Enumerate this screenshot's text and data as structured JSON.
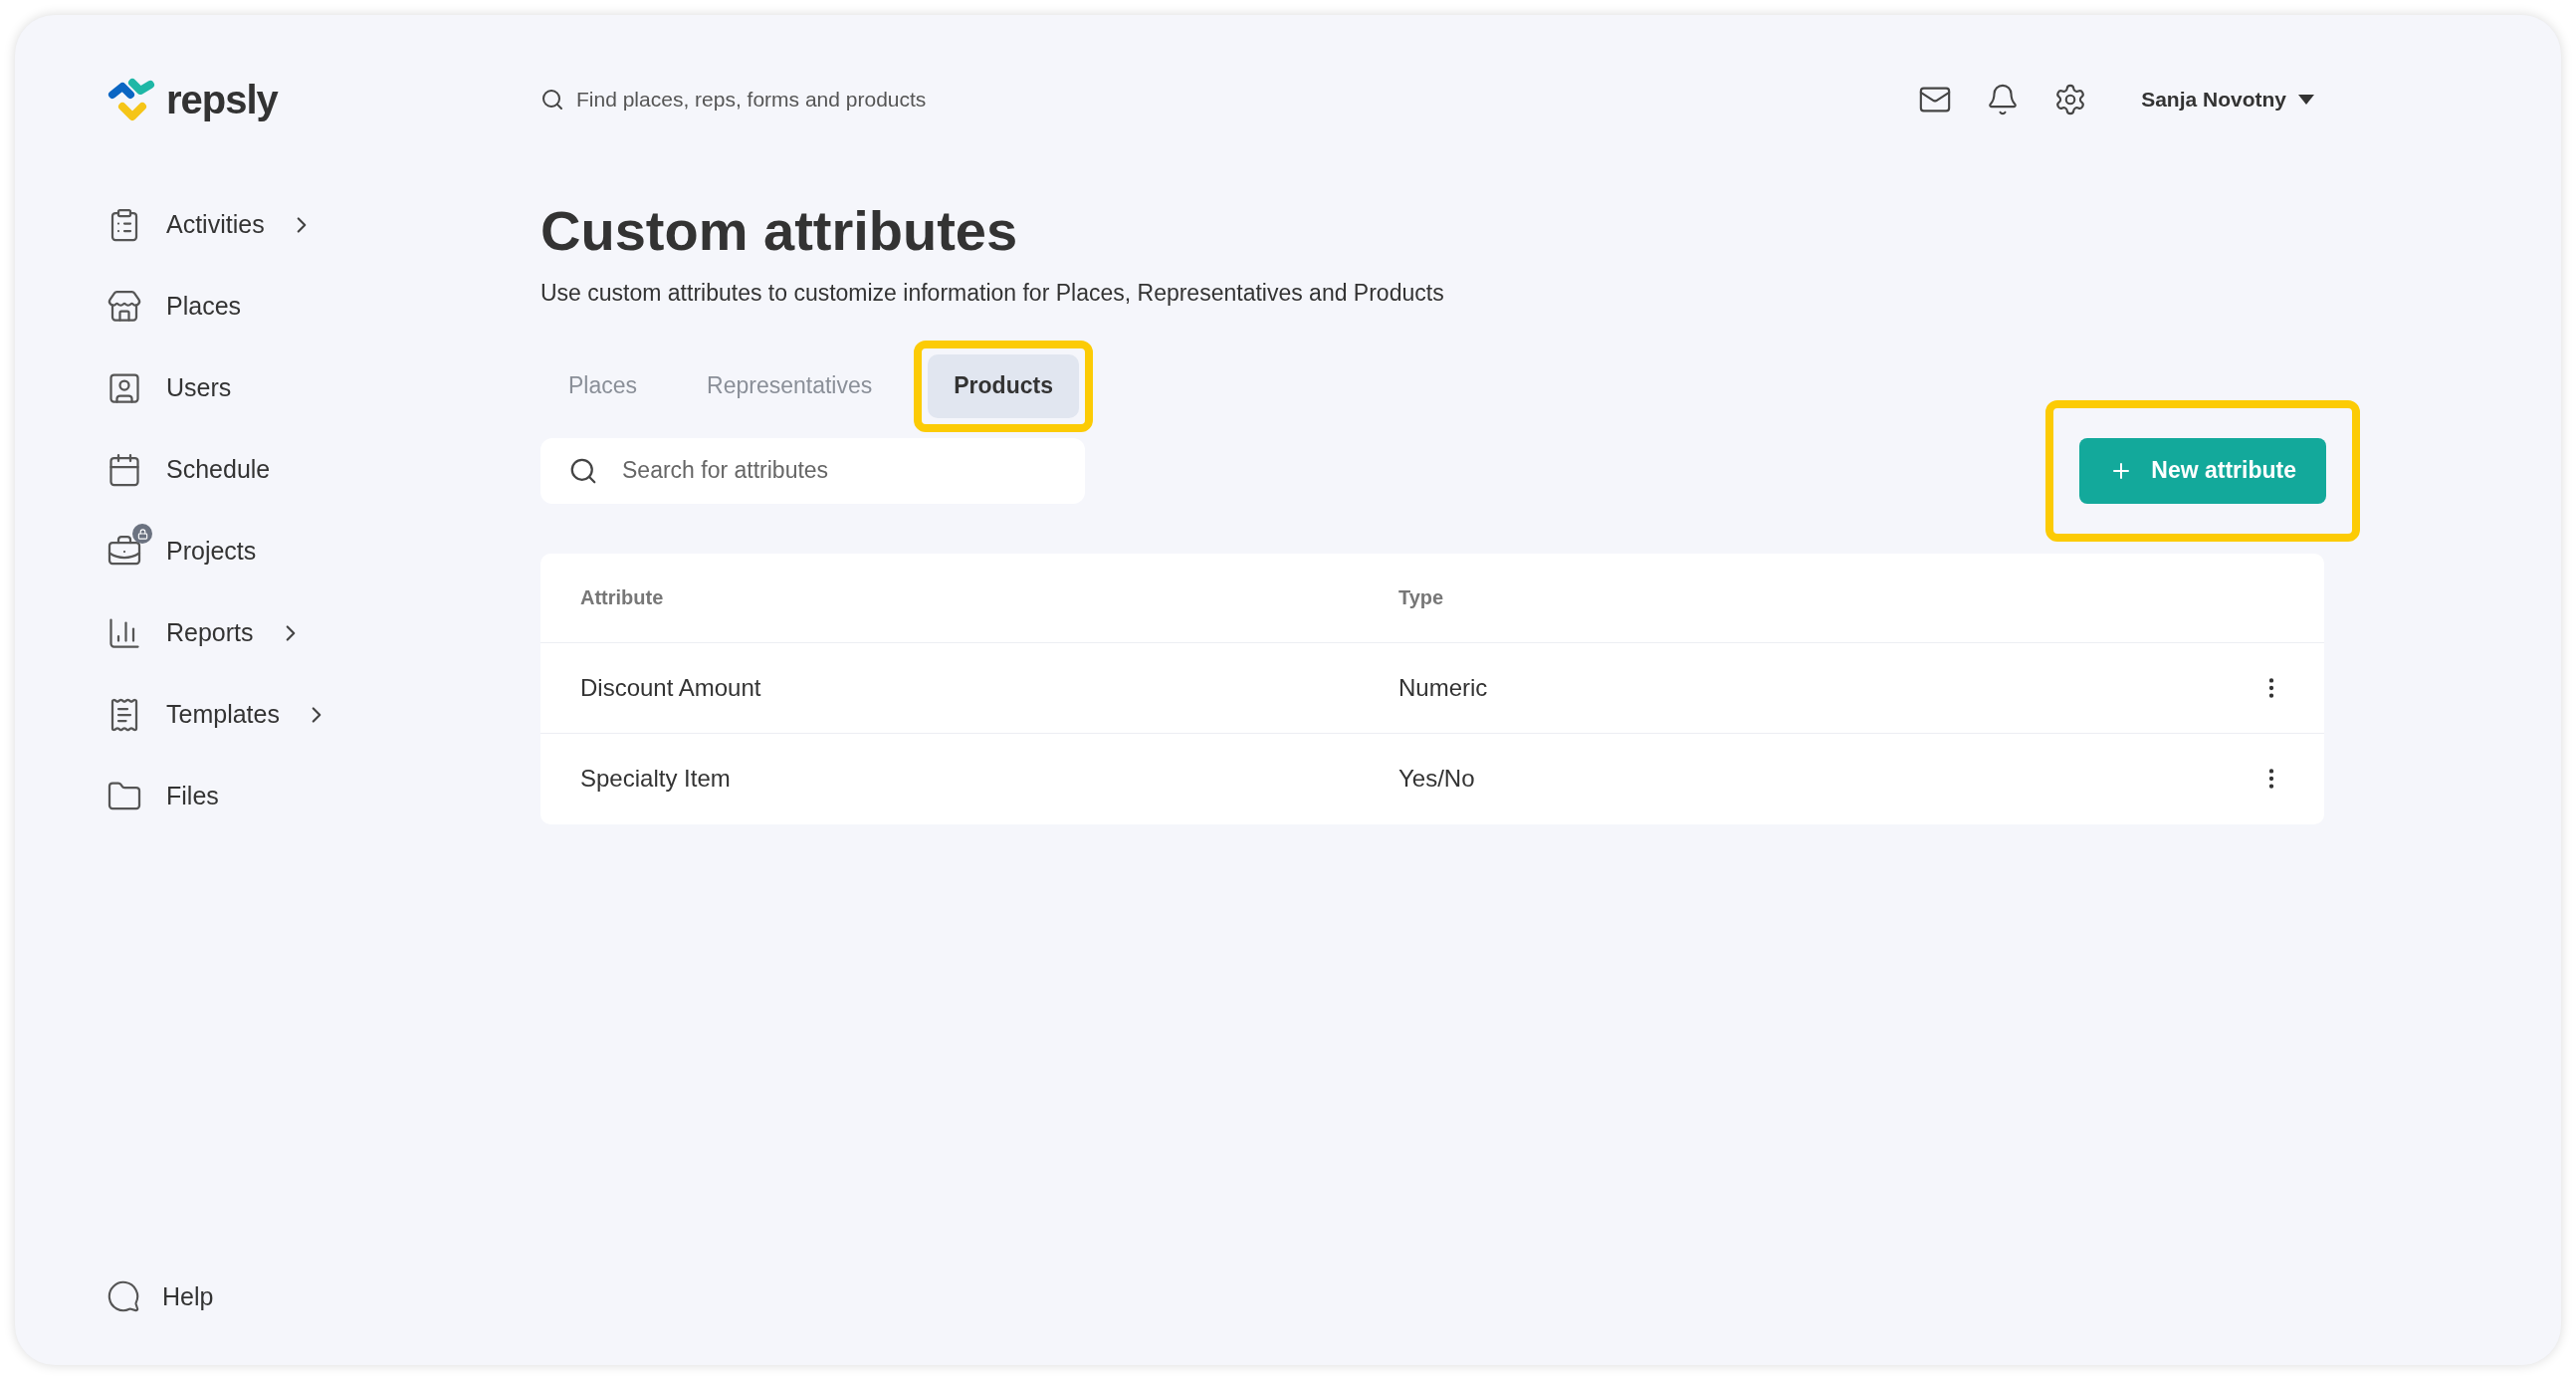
{
  "logo": {
    "text": "repsly"
  },
  "search": {
    "placeholder": "Find places, reps, forms and products"
  },
  "user": {
    "name": "Sanja Novotny"
  },
  "sidebar": {
    "items": [
      {
        "label": "Activities",
        "has_submenu": true,
        "locked": false
      },
      {
        "label": "Places",
        "has_submenu": false,
        "locked": false
      },
      {
        "label": "Users",
        "has_submenu": false,
        "locked": false
      },
      {
        "label": "Schedule",
        "has_submenu": false,
        "locked": false
      },
      {
        "label": "Projects",
        "has_submenu": false,
        "locked": true
      },
      {
        "label": "Reports",
        "has_submenu": true,
        "locked": false
      },
      {
        "label": "Templates",
        "has_submenu": true,
        "locked": false
      },
      {
        "label": "Files",
        "has_submenu": false,
        "locked": false
      }
    ],
    "help": "Help"
  },
  "page": {
    "title": "Custom attributes",
    "description": "Use custom attributes to customize information for Places, Representatives and Products"
  },
  "tabs": [
    {
      "label": "Places",
      "selected": false,
      "highlighted": false
    },
    {
      "label": "Representatives",
      "selected": false,
      "highlighted": false
    },
    {
      "label": "Products",
      "selected": true,
      "highlighted": true
    }
  ],
  "attribute_search": {
    "placeholder": "Search for attributes"
  },
  "new_button": {
    "label": "New attribute",
    "highlighted": true
  },
  "table": {
    "columns": [
      "Attribute",
      "Type"
    ],
    "rows": [
      {
        "attribute": "Discount Amount",
        "type": "Numeric"
      },
      {
        "attribute": "Specialty Item",
        "type": "Yes/No"
      }
    ]
  }
}
